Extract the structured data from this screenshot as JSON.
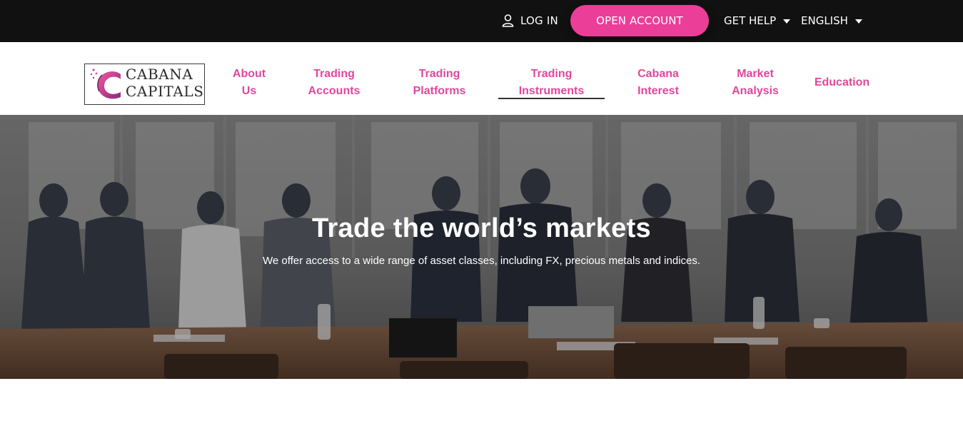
{
  "topbar": {
    "login_label": "LOG IN",
    "login_icon": "user-icon",
    "open_account_label": "OPEN ACCOUNT",
    "get_help_label": "GET HELP",
    "language_label": "ENGLISH"
  },
  "logo": {
    "line1": "CABANA",
    "line2": "CAPITALS"
  },
  "nav": {
    "items": [
      {
        "line1": "About",
        "line2": "Us"
      },
      {
        "line1": "Trading",
        "line2": "Accounts"
      },
      {
        "line1": "Trading",
        "line2": "Platforms"
      },
      {
        "line1": "Trading",
        "line2": "Instruments"
      },
      {
        "line1": "Cabana",
        "line2": "Interest"
      },
      {
        "line1": "Market",
        "line2": "Analysis"
      },
      {
        "line1": "Education",
        "line2": ""
      }
    ],
    "active_index": 3
  },
  "hero": {
    "title": "Trade the world’s markets",
    "subtitle": "We offer access to a wide range of asset classes, including FX, precious metals and indices."
  },
  "colors": {
    "brand_pink": "#e0479b",
    "button_pink": "#ea3e98",
    "topbar_bg": "#111111"
  }
}
